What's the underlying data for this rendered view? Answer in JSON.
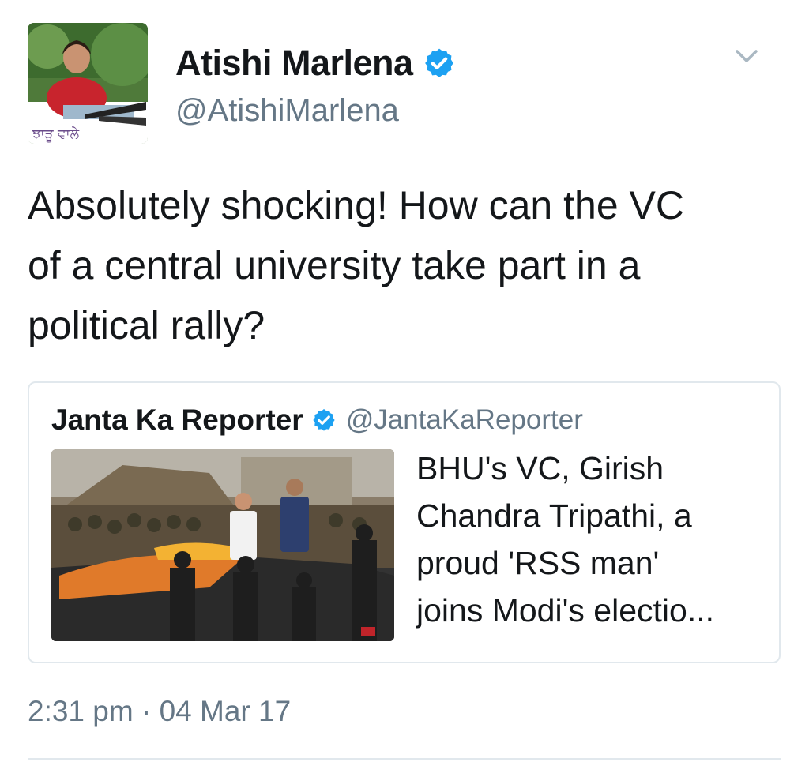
{
  "tweet": {
    "display_name": "Atishi Marlena",
    "handle": "@AtishiMarlena",
    "avatar_caption": "ਝਾੜੂ ਵਾਲੇ",
    "verified": true,
    "text": "Absolutely shocking! How can the VC\nof a central university take part in a\npolitical rally?",
    "timestamp": "2:31 pm · 04 Mar 17"
  },
  "quoted_tweet": {
    "display_name": "Janta Ka Reporter",
    "handle": "@JantaKaReporter",
    "verified": true,
    "text": "BHU's VC, Girish\nChandra Tripathi, a\nproud 'RSS man'\njoins Modi's electio..."
  },
  "icons": {
    "verified": "verified-badge-icon",
    "menu": "chevron-down-icon"
  },
  "colors": {
    "verified_blue": "#1da1f2",
    "secondary_text": "#657786",
    "border": "#e1e8ed"
  }
}
